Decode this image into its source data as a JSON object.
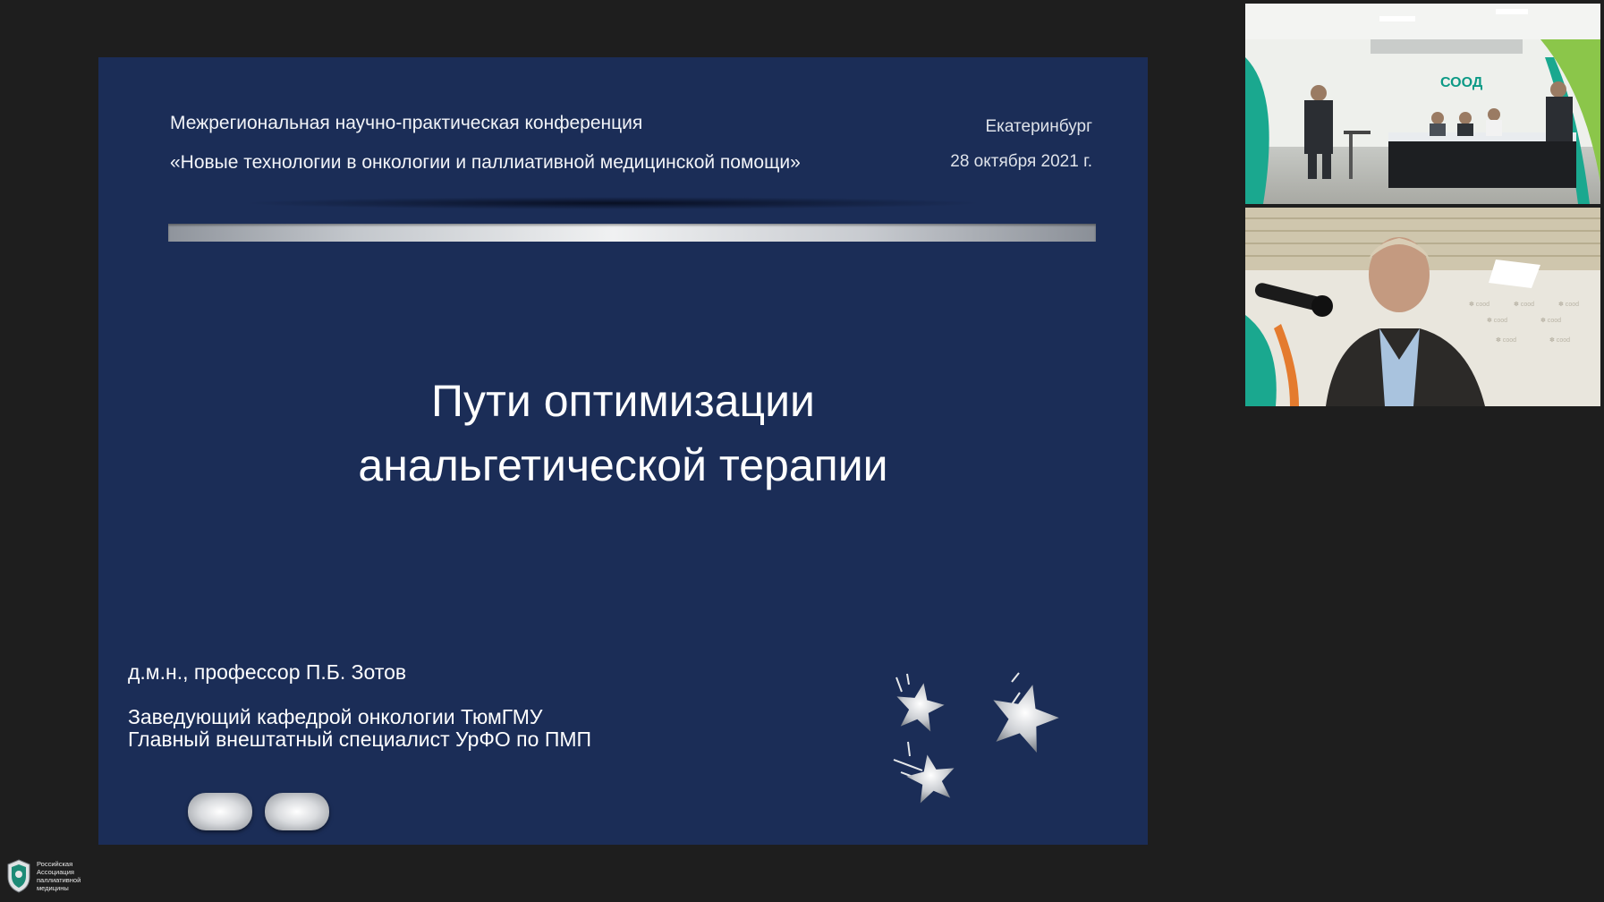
{
  "slide": {
    "conference_line1": "Межрегиональная научно-практическая конференция",
    "conference_line2": "«Новые технологии в онкологии и паллиативной медицинской помощи»",
    "city": "Екатеринбург",
    "date": "28 октября 2021 г.",
    "title_line1": "Пути оптимизации",
    "title_line2": "анальгетической терапии",
    "author": "д.м.н., профессор  П.Б. Зотов",
    "position_line1": "Заведующий кафедрой онкологии ТюмГМУ",
    "position_line2": "Главный внештатный специалист УрФО по ПМП",
    "nav": {
      "prev_icon": "prev-slide-button",
      "next_icon": "next-slide-button"
    }
  },
  "videos": {
    "room_sign": "СООД"
  },
  "logo": {
    "lines": [
      "Российская",
      "Ассоциация",
      "паллиативной",
      "медицины"
    ]
  },
  "colors": {
    "slide_background": "#1b2d57",
    "page_background": "#1e1e1e",
    "accent_green": "#0c9a86"
  }
}
